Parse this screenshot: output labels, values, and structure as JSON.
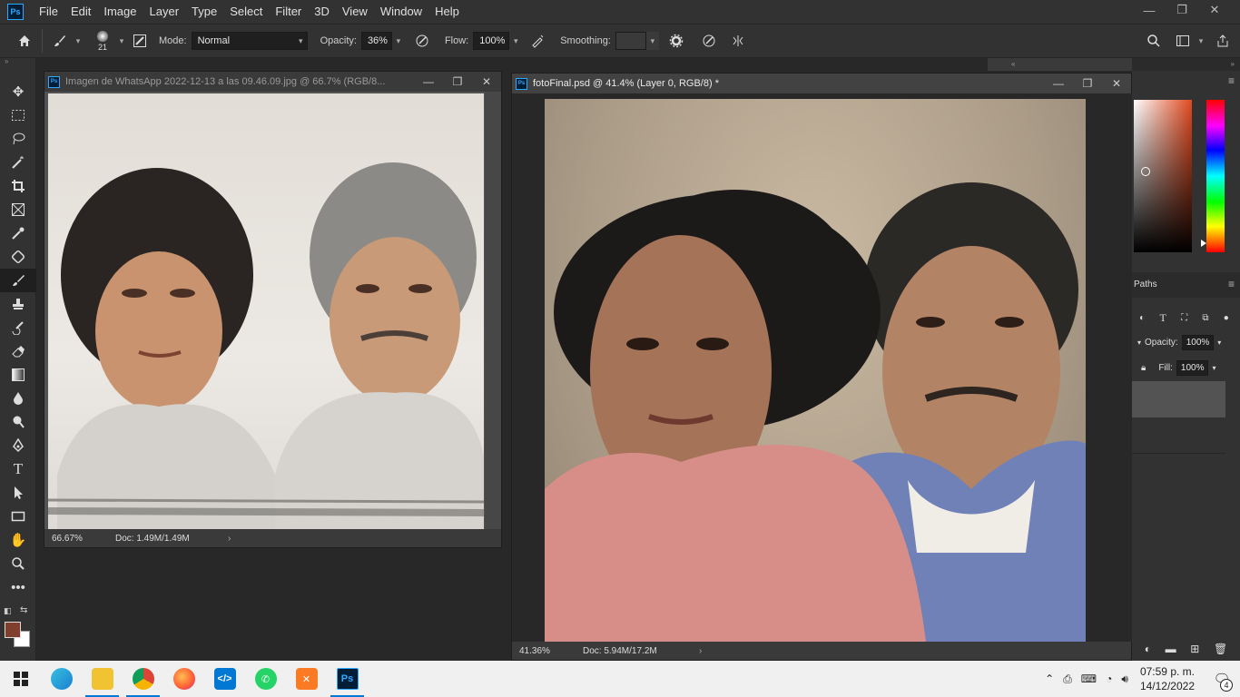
{
  "menu": {
    "items": [
      "File",
      "Edit",
      "Image",
      "Layer",
      "Type",
      "Select",
      "Filter",
      "3D",
      "View",
      "Window",
      "Help"
    ]
  },
  "app_logo_text": "Ps",
  "options_bar": {
    "brush_size": "21",
    "mode_label": "Mode:",
    "mode_value": "Normal",
    "opacity_label": "Opacity:",
    "opacity_value": "36%",
    "flow_label": "Flow:",
    "flow_value": "100%",
    "smoothing_label": "Smoothing:",
    "smoothing_value": ""
  },
  "documents": [
    {
      "title": "Imagen de WhatsApp 2022-12-13 a las 09.46.09.jpg @ 66.7% (RGB/8...",
      "zoom": "66.67%",
      "doc_info": "Doc: 1.49M/1.49M"
    },
    {
      "title": "fotoFinal.psd @ 41.4% (Layer 0, RGB/8) *",
      "zoom": "41.36%",
      "doc_info": "Doc: 5.94M/17.2M"
    }
  ],
  "panels": {
    "paths_tab": "Paths",
    "opacity_label": "Opacity:",
    "opacity_value": "100%",
    "fill_label": "Fill:",
    "fill_value": "100%"
  },
  "colors": {
    "foreground": "#7f3f2c",
    "background": "#ffffff",
    "accent": "#31a8ff"
  },
  "taskbar": {
    "apps": [
      "windows-start",
      "edge",
      "file-explorer",
      "chrome",
      "firefox",
      "vscode",
      "whatsapp",
      "xampp",
      "photoshop"
    ],
    "time": "07:59 p. m.",
    "date": "14/12/2022",
    "notifications": "4"
  }
}
